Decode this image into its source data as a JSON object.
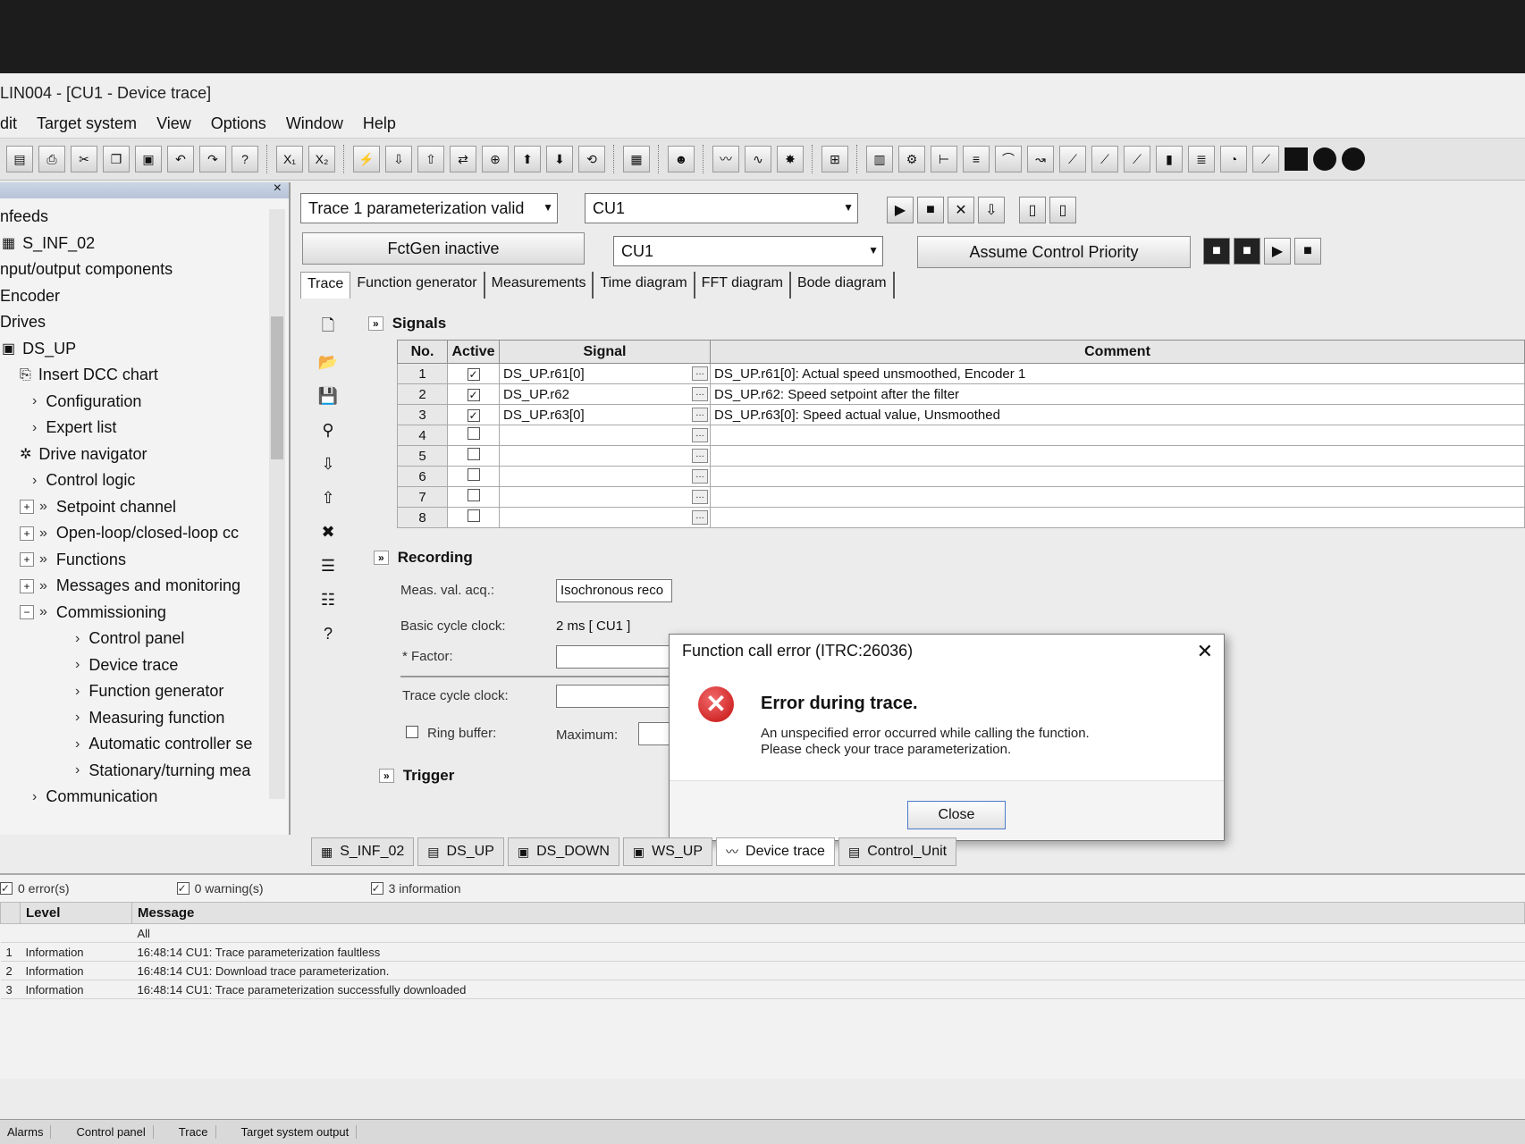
{
  "window": {
    "title": "LIN004 - [CU1 - Device trace]"
  },
  "menu": [
    "dit",
    "Target system",
    "View",
    "Options",
    "Window",
    "Help"
  ],
  "tree": {
    "items": [
      {
        "label": "nfeeds",
        "level": 0,
        "icon": ""
      },
      {
        "label": "S_INF_02",
        "level": 1,
        "icon": "grid-icon"
      },
      {
        "label": "nput/output components",
        "level": 0,
        "icon": ""
      },
      {
        "label": "Encoder",
        "level": 0,
        "icon": ""
      },
      {
        "label": "Drives",
        "level": 0,
        "icon": ""
      },
      {
        "label": "DS_UP",
        "level": 1,
        "icon": "drive-icon"
      },
      {
        "label": "Insert DCC chart",
        "level": 2,
        "icon": "insert-icon"
      },
      {
        "label": "Configuration",
        "level": 2,
        "icon": "chevron"
      },
      {
        "label": "Expert list",
        "level": 2,
        "icon": "chevron"
      },
      {
        "label": "Drive navigator",
        "level": 2,
        "icon": "navigator-icon"
      },
      {
        "label": "Control logic",
        "level": 2,
        "icon": "chevron"
      },
      {
        "label": "Setpoint channel",
        "level": 2,
        "icon": "expand"
      },
      {
        "label": "Open-loop/closed-loop cc",
        "level": 2,
        "icon": "expand"
      },
      {
        "label": "Functions",
        "level": 2,
        "icon": "expand"
      },
      {
        "label": "Messages and monitoring",
        "level": 2,
        "icon": "expand"
      },
      {
        "label": "Commissioning",
        "level": 2,
        "icon": "collapse"
      },
      {
        "label": "Control panel",
        "level": 3,
        "icon": "chevron"
      },
      {
        "label": "Device trace",
        "level": 3,
        "icon": "chevron"
      },
      {
        "label": "Function generator",
        "level": 3,
        "icon": "chevron"
      },
      {
        "label": "Measuring function",
        "level": 3,
        "icon": "chevron"
      },
      {
        "label": "Automatic controller se",
        "level": 3,
        "icon": "chevron"
      },
      {
        "label": "Stationary/turning mea",
        "level": 3,
        "icon": "chevron"
      },
      {
        "label": "Communication",
        "level": 2,
        "icon": "chevron"
      }
    ]
  },
  "trace": {
    "status_combo": "Trace 1 parameterization valid",
    "device_combo": "CU1",
    "fctgen_status": "FctGen  inactive",
    "fctgen_device": "CU1",
    "assume_priority": "Assume Control Priority"
  },
  "tabs": [
    "Trace",
    "Function generator",
    "Measurements",
    "Time diagram",
    "FFT diagram",
    "Bode diagram"
  ],
  "signals": {
    "header": "Signals",
    "columns": {
      "no": "No.",
      "active": "Active",
      "signal": "Signal",
      "comment": "Comment"
    },
    "rows": [
      {
        "no": "1",
        "active": true,
        "signal": "DS_UP.r61[0]",
        "comment": "DS_UP.r61[0]: Actual speed unsmoothed, Encoder 1"
      },
      {
        "no": "2",
        "active": true,
        "signal": "DS_UP.r62",
        "comment": "DS_UP.r62: Speed setpoint after the filter"
      },
      {
        "no": "3",
        "active": true,
        "signal": "DS_UP.r63[0]",
        "comment": "DS_UP.r63[0]: Speed actual value, Unsmoothed"
      },
      {
        "no": "4",
        "active": false,
        "signal": "",
        "comment": ""
      },
      {
        "no": "5",
        "active": false,
        "signal": "",
        "comment": ""
      },
      {
        "no": "6",
        "active": false,
        "signal": "",
        "comment": ""
      },
      {
        "no": "7",
        "active": false,
        "signal": "",
        "comment": ""
      },
      {
        "no": "8",
        "active": false,
        "signal": "",
        "comment": ""
      }
    ]
  },
  "recording": {
    "header": "Recording",
    "meas_label": "Meas. val. acq.:",
    "meas_value": "Isochronous reco",
    "basic_cycle_label": "Basic cycle clock:",
    "basic_cycle_value": "2 ms    [ CU1 ]",
    "factor_label": "* Factor:",
    "trace_cycle_label": "Trace cycle clock:",
    "ring_buffer_label": "Ring buffer:",
    "maximum_label": "Maximum:"
  },
  "trigger": {
    "header": "Trigger"
  },
  "dialog": {
    "title": "Function call error (ITRC:26036)",
    "heading": "Error during trace.",
    "line1": "An unspecified error occurred while calling the function.",
    "line2": "Please check your trace parameterization.",
    "close_button": "Close"
  },
  "bottom_tabs": [
    {
      "label": "S_INF_02",
      "icon": "grid-icon"
    },
    {
      "label": "DS_UP",
      "icon": "list-icon"
    },
    {
      "label": "DS_DOWN",
      "icon": "drive-icon"
    },
    {
      "label": "WS_UP",
      "icon": "drive-icon"
    },
    {
      "label": "Device trace",
      "icon": "trace-icon"
    },
    {
      "label": "Control_Unit",
      "icon": "list-icon"
    }
  ],
  "log": {
    "filters": [
      "0 error(s)",
      "0 warning(s)",
      "3 information"
    ],
    "columns": {
      "level": "Level",
      "message": "Message"
    },
    "filter_all": "All",
    "rows": [
      {
        "no": "1",
        "level": "Information",
        "message": "16:48:14 CU1: Trace parameterization faultless"
      },
      {
        "no": "2",
        "level": "Information",
        "message": "16:48:14 CU1: Download trace parameterization."
      },
      {
        "no": "3",
        "level": "Information",
        "message": "16:48:14 CU1: Trace parameterization successfully downloaded"
      }
    ]
  },
  "taskbar": [
    "Alarms",
    "Control panel",
    "Trace",
    "Target system output"
  ]
}
